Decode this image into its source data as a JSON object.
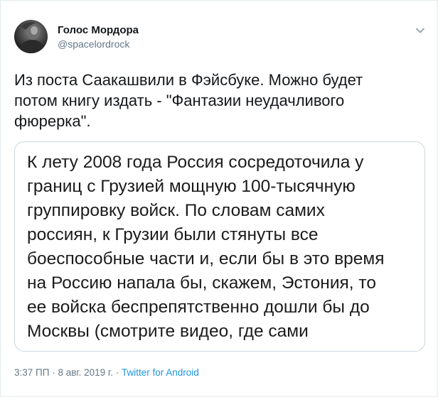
{
  "author": {
    "name": "Голос Мордора",
    "handle": "@spacelordrock"
  },
  "tweet": {
    "text": "Из поста Саакашвили в Фэйсбуке. Можно будет\nпотом книгу издать - \"Фантазии неудачливого\nфюрерка\"."
  },
  "media": {
    "text": "К лету 2008 года Россия сосредоточила у\nграниц с Грузией мощную 100-тысячную\nгруппировку войск. По словам самих\nроссиян, к Грузии были стянуты все\nбоеспособные части и, если бы в это время\nна Россию напала бы, скажем, Эстония, то\nее войска беспрепятственно дошли бы до\nМосквы (смотрите видео, где сами"
  },
  "meta": {
    "time": "3:37 ПП",
    "sep1": " · ",
    "date": "8 авг. 2019 г.",
    "sep2": " · ",
    "source": "Twitter for Android"
  },
  "icons": {
    "menu": "chevron-down-icon"
  },
  "colors": {
    "secondary_text": "#657786",
    "link": "#1b95e0",
    "border": "#e1e8ed"
  }
}
